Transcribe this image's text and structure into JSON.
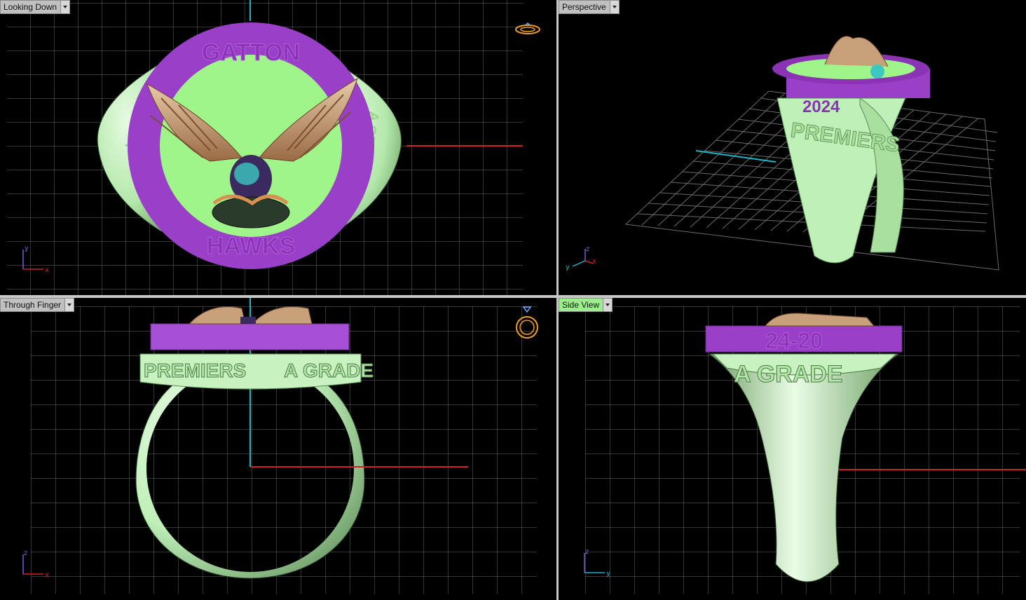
{
  "viewports": {
    "top": {
      "label": "Looking Down"
    },
    "persp": {
      "label": "Perspective"
    },
    "front": {
      "label": "Through Finger"
    },
    "side": {
      "label": "Side View"
    }
  },
  "ring_text": {
    "top_arc": "GATTON",
    "bottom_arc": "HAWKS",
    "shank_left": "PREMIERS",
    "shank_right": "A GRADE",
    "year": "2024",
    "score": "24-20"
  },
  "axes": {
    "top": [
      "x",
      "y"
    ],
    "persp": [
      "x",
      "y",
      "z"
    ],
    "front": [
      "x",
      "z"
    ],
    "side": [
      "y",
      "z"
    ]
  },
  "colors": {
    "viewport_bg": "#000000",
    "grid": "#6e6e6e",
    "ring_green": "#bff0b8",
    "bezel_purple": "#9a3fc8",
    "inner_green": "#9ff58a",
    "eagle_gold": "#c8a07a",
    "axis_x": "#d02020",
    "axis_y": "#18b8c8",
    "active_tab": "#99f08a"
  },
  "icons": [
    "ring-top-view-icon",
    "ring-front-view-icon"
  ]
}
